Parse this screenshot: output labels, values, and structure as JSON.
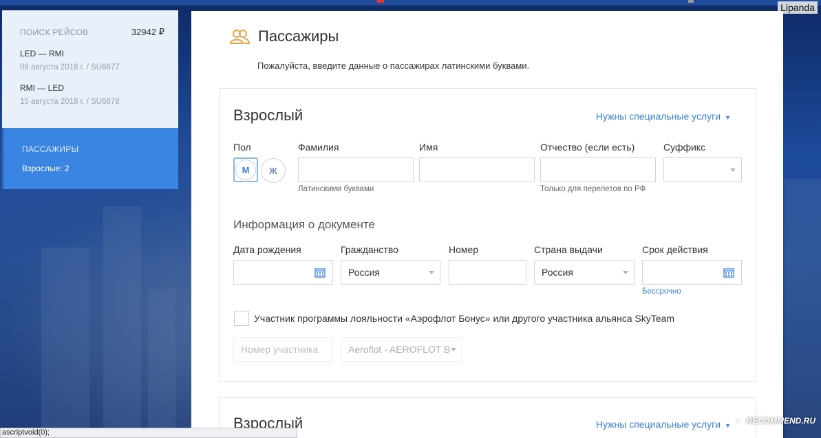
{
  "user": "Lipanda",
  "sidebar": {
    "search_title": "ПОИСК РЕЙСОВ",
    "price": "32942 ₽",
    "routes": [
      {
        "route": "LED — RMI",
        "details": "08 августа 2018 г. / SU6677"
      },
      {
        "route": "RMI — LED",
        "details": "15 августа 2018 г. / SU6678"
      }
    ],
    "passengers_title": "ПАССАЖИРЫ",
    "passengers_count": "Взрослые: 2"
  },
  "main": {
    "title": "Пассажиры",
    "subtitle": "Пожалуйста, введите данные о пассажирах латинскими буквами."
  },
  "passenger1": {
    "title": "Взрослый",
    "special_services": "Нужны специальные услуги",
    "gender_label": "Пол",
    "gender_male": "М",
    "gender_female": "Ж",
    "surname_label": "Фамилия",
    "surname_hint": "Латинскими буквами",
    "name_label": "Имя",
    "patronymic_label": "Отчество (если есть)",
    "patronymic_hint": "Только для перелетов по РФ",
    "suffix_label": "Суффикс",
    "doc_section": "Информация о документе",
    "birth_label": "Дата рождения",
    "citizenship_label": "Гражданство",
    "citizenship_value": "Россия",
    "number_label": "Номер",
    "issue_country_label": "Страна выдачи",
    "issue_country_value": "Россия",
    "validity_label": "Срок действия",
    "validity_link": "Бессрочно",
    "loyalty_label": "Участник программы лояльности «Аэрофлот Бонус» или другого участника альянса SkyTeam",
    "member_number_placeholder": "Номер участника",
    "program_value": "Aeroflot - AEROFLOT B"
  },
  "passenger2": {
    "title": "Взрослый",
    "special_services": "Нужны специальные услуги"
  },
  "statusbar": "ascriptvoid(0);",
  "watermark": "RECOMMEND.RU",
  "colors": {
    "accent": "#3c82d8",
    "sidebar_active": "#3a85e2",
    "sidebar_panel": "#e8f0fa",
    "icon_orange": "#e8a34c"
  }
}
